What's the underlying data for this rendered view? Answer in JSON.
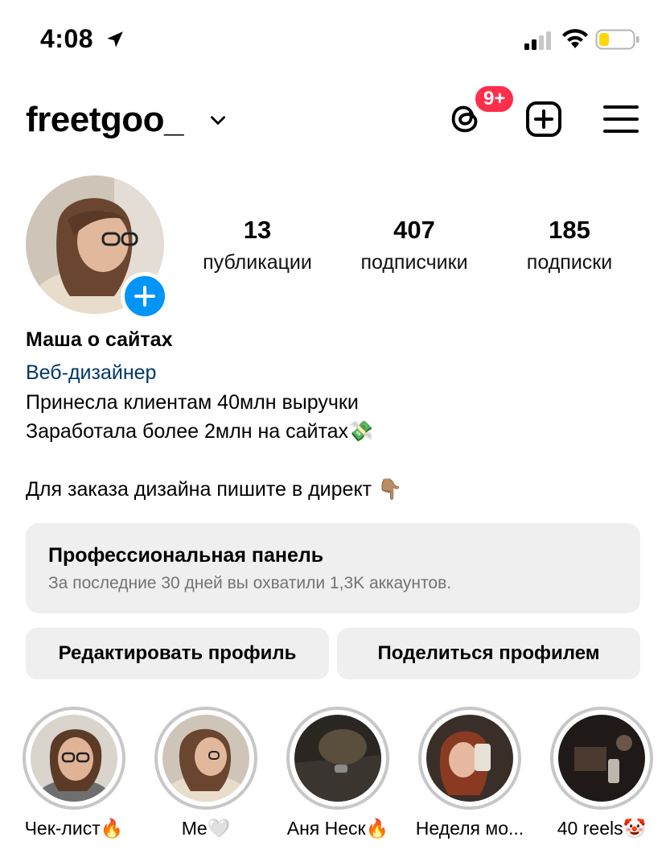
{
  "status_bar": {
    "time": "4:08",
    "icons": [
      "location-arrow-icon",
      "signal-icon",
      "wifi-icon",
      "battery-low-icon"
    ]
  },
  "header": {
    "username": "freetgoo_",
    "threads_badge": "9+",
    "icons": [
      "chevron-down-icon",
      "threads-icon",
      "plus-square-icon",
      "menu-icon"
    ]
  },
  "profile": {
    "stats": [
      {
        "value": "13",
        "label": "публикации"
      },
      {
        "value": "407",
        "label": "подписчики"
      },
      {
        "value": "185",
        "label": "подписки"
      }
    ],
    "name": "Маша о сайтах",
    "category": "Веб-дизайнер",
    "bio_lines": [
      "Принесла клиентам 40млн выручки",
      "Заработала более 2млн на сайтах💸",
      "",
      "Для заказа дизайна пишите в директ 👇🏽"
    ]
  },
  "professional_panel": {
    "title": "Профессиональная панель",
    "subtitle": "За последние 30 дней вы охватили 1,3K аккаунтов."
  },
  "buttons": {
    "edit": "Редактировать профиль",
    "share": "Поделиться профилем"
  },
  "highlights": [
    {
      "label": "Чек-лист🔥"
    },
    {
      "label": "Me🤍"
    },
    {
      "label": "Аня Неск🔥"
    },
    {
      "label": "Неделя мо..."
    },
    {
      "label": "40 reels🤡"
    }
  ],
  "colors": {
    "accent_blue": "#0095f6",
    "badge_red": "#ff2e4a",
    "link_blue": "#00376b",
    "panel_bg": "#efefef",
    "battery_yellow": "#ffd60a"
  }
}
